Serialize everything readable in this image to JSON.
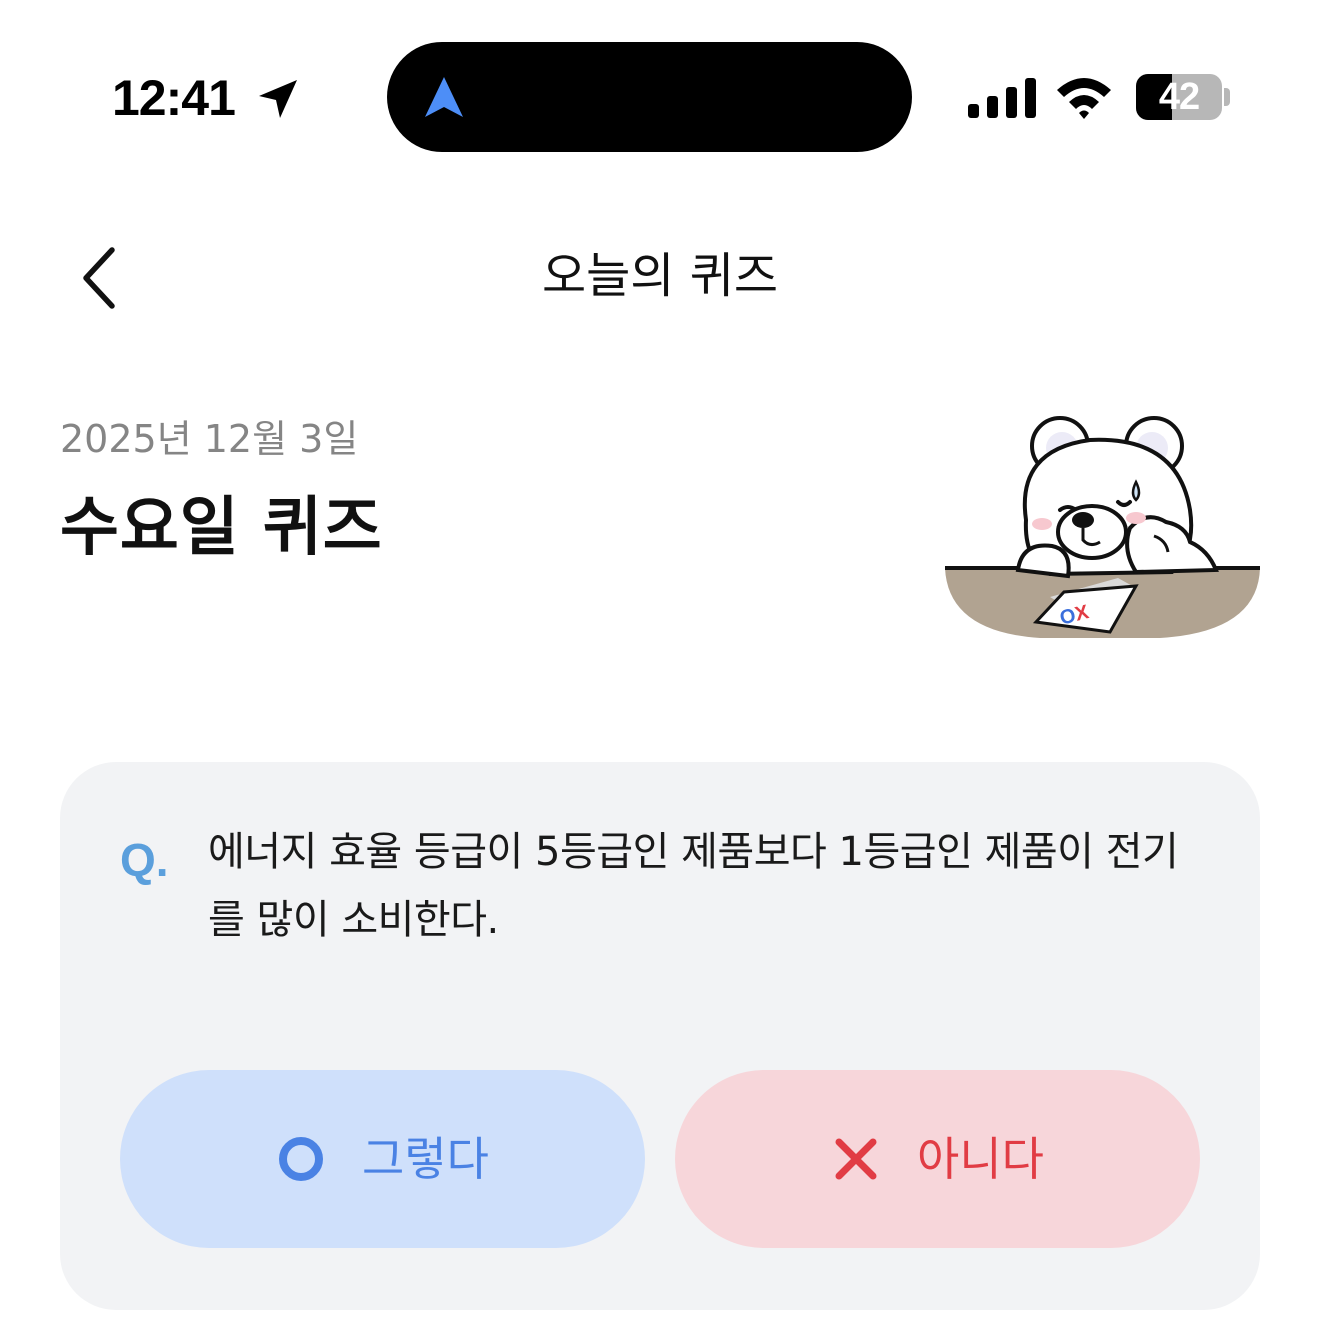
{
  "status_bar": {
    "time": "12:41",
    "battery_level": "42",
    "battery_fraction": 0.42
  },
  "nav": {
    "title": "오늘의 퀴즈"
  },
  "header": {
    "date": "2025년 12월 3일",
    "title": "수요일 퀴즈"
  },
  "mascot": {
    "paper_text": "OX"
  },
  "quiz": {
    "q_mark": "Q.",
    "question": "에너지 효율 등급이 5등급인 제품보다 1등급인 제품이 전기를 많이 소비한다.",
    "yes_label": "그렇다",
    "no_label": "아니다"
  },
  "colors": {
    "accent_blue": "#4a82e4",
    "accent_red": "#e13c44",
    "yes_bg": "#cfe0fb",
    "no_bg": "#f7d6da",
    "card_bg": "#f2f3f5",
    "q_mark": "#5b9fdc"
  },
  "icons": {
    "back": "chevron-left-icon",
    "location": "location-arrow-icon",
    "navigation": "navigation-arrow-icon",
    "signal": "cellular-signal-icon",
    "wifi": "wifi-icon",
    "battery": "battery-icon",
    "yes": "circle-o-icon",
    "no": "x-cross-icon"
  }
}
